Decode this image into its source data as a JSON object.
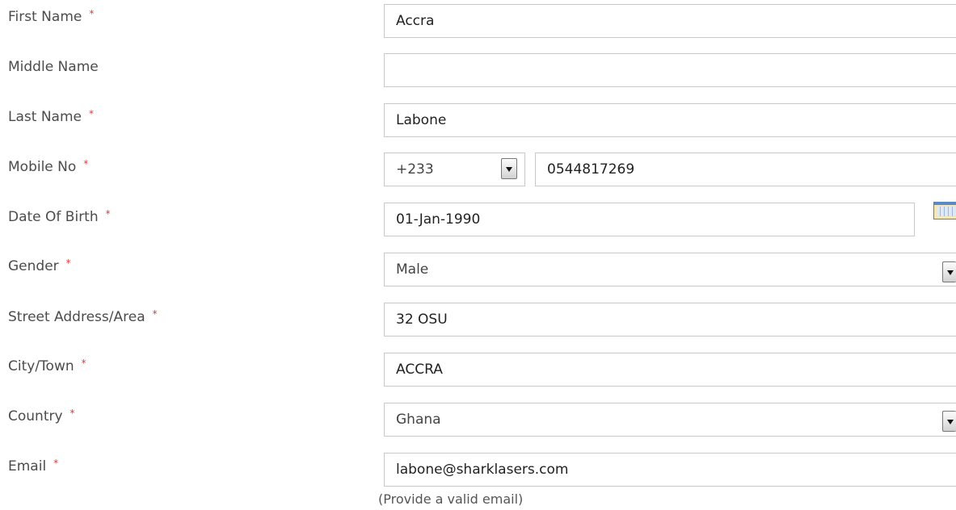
{
  "fields": {
    "first_name": {
      "label": "First Name",
      "required_mark": "*",
      "value": "Accra"
    },
    "middle_name": {
      "label": "Middle Name",
      "value": ""
    },
    "last_name": {
      "label": "Last Name",
      "required_mark": "*",
      "value": "Labone"
    },
    "mobile_no": {
      "label": "Mobile No",
      "required_mark": "*",
      "country_code": "+233",
      "value": "0544817269"
    },
    "date_of_birth": {
      "label": "Date Of Birth",
      "required_mark": "*",
      "value": "01-Jan-1990"
    },
    "gender": {
      "label": "Gender",
      "required_mark": "*",
      "selected": "Male"
    },
    "street_address": {
      "label": "Street Address/Area",
      "required_mark": "*",
      "value": "32 OSU"
    },
    "city_town": {
      "label": "City/Town",
      "required_mark": "*",
      "value": "ACCRA"
    },
    "country": {
      "label": "Country",
      "required_mark": "*",
      "selected": "Ghana"
    },
    "email": {
      "label": "Email",
      "required_mark": "*",
      "value": "labone@sharklasers.com",
      "hint": "(Provide a valid email)"
    }
  },
  "icons": {
    "calendar": "calendar-icon",
    "dropdown": "chevron-down-icon"
  }
}
